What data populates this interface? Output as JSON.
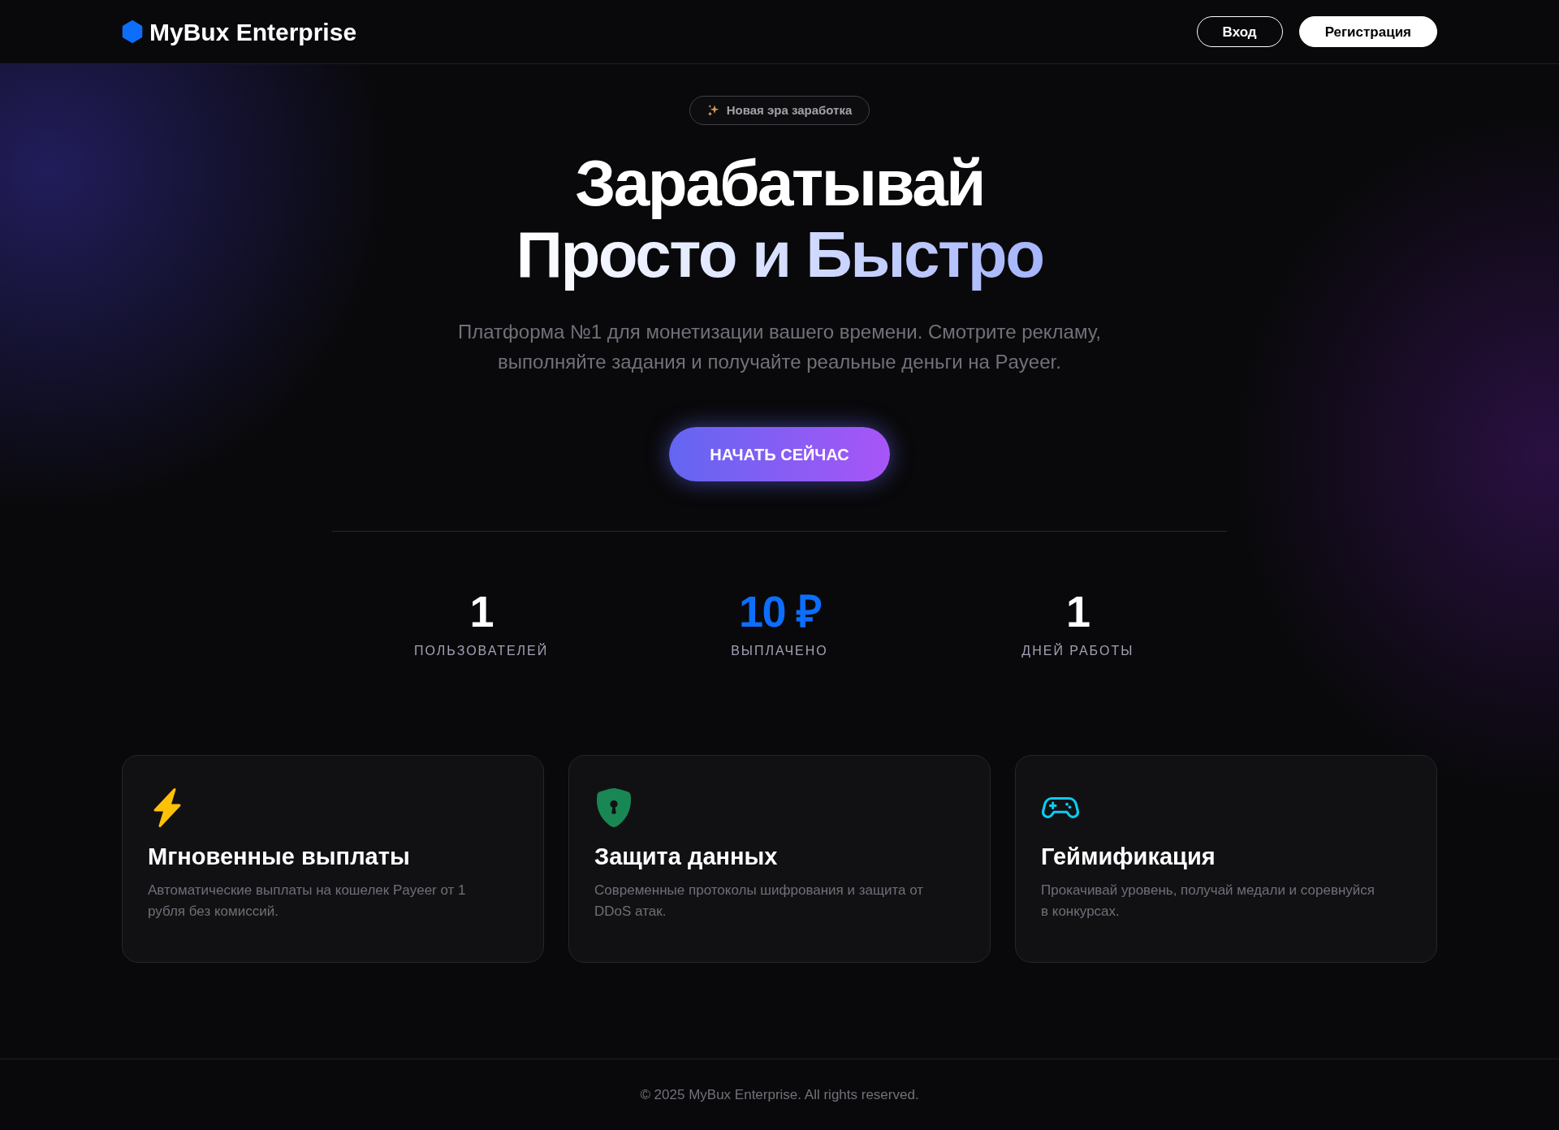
{
  "navbar": {
    "brand": "MyBux Enterprise",
    "buttons": [
      {
        "label": "Вход",
        "kind": "outline"
      },
      {
        "label": "Регистрация",
        "kind": "solid"
      }
    ]
  },
  "hero": {
    "badge": "Новая эра заработка",
    "heading": {
      "text": "Зарабатывай",
      "highlight": "Просто и Быстро"
    },
    "subtitle": "Платформа №1 для монетизации вашего времени. Смотрите рекламу, выполняйте задания и получайте реальные деньги на Payeer.",
    "cta": "НАЧАТЬ СЕЙЧАС"
  },
  "stats": [
    {
      "value": "1",
      "label": "ПОЛЬЗОВАТЕЛЕЙ",
      "color": "#ffffff"
    },
    {
      "value": "10 ₽",
      "label": "ВЫПЛАЧЕНО",
      "color": "#0d6efd"
    },
    {
      "value": "1",
      "label": "ДНЕЙ РАБОТЫ",
      "color": "#ffffff"
    }
  ],
  "features": [
    {
      "title": "Мгновенные выплаты",
      "text": "Автоматические выплаты на кошелек Payeer от 1 рубля без комиссий.",
      "color": "#ffc107"
    },
    {
      "title": "Защита данных",
      "text": "Современные протоколы шифрования и защита от DDoS атак.",
      "color": "#198754"
    },
    {
      "title": "Геймификация",
      "text": "Прокачивай уровень, получай медали и соревнуйся в конкурсах.",
      "color": "#0dcaf0"
    }
  ],
  "footer": {
    "text": "© 2025 MyBux Enterprise. All rights reserved."
  }
}
